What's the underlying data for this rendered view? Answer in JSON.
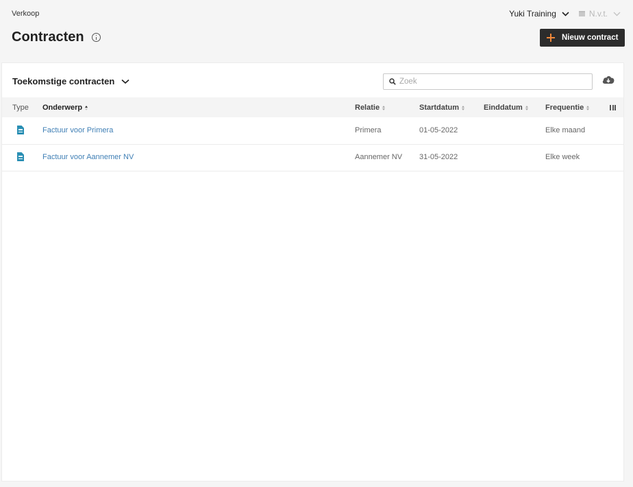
{
  "breadcrumb": "Verkoop",
  "company": {
    "name": "Yuki Training"
  },
  "period": {
    "label": "N.v.t."
  },
  "page": {
    "title": "Contracten"
  },
  "actions": {
    "new_contract": "Nieuw contract"
  },
  "view": {
    "label": "Toekomstige contracten"
  },
  "search": {
    "placeholder": "Zoek",
    "value": ""
  },
  "table": {
    "columns": {
      "type": "Type",
      "subject": "Onderwerp",
      "relation": "Relatie",
      "start": "Startdatum",
      "end": "Einddatum",
      "frequency": "Frequentie"
    },
    "sorted_by": "Onderwerp",
    "rows": [
      {
        "type_icon": "invoice-document-icon",
        "subject": "Factuur voor Primera",
        "relation": "Primera",
        "start": "01-05-2022",
        "end": "",
        "frequency": "Elke maand"
      },
      {
        "type_icon": "invoice-document-icon",
        "subject": "Factuur voor Aannemer NV",
        "relation": "Aannemer NV",
        "start": "31-05-2022",
        "end": "",
        "frequency": "Elke week"
      }
    ]
  },
  "colors": {
    "link": "#3f7fb5",
    "accent": "#f0883a",
    "button": "#2c2c2c",
    "icon": "#2a8fb4"
  }
}
